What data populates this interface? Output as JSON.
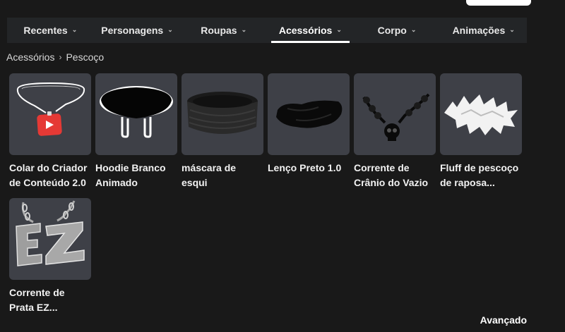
{
  "tabs": [
    {
      "label": "Recentes"
    },
    {
      "label": "Personagens"
    },
    {
      "label": "Roupas"
    },
    {
      "label": "Acessórios"
    },
    {
      "label": "Corpo"
    },
    {
      "label": "Animações"
    }
  ],
  "active_tab": "Acessórios",
  "breadcrumb": {
    "parent": "Acessórios",
    "current": "Pescoço"
  },
  "items": [
    {
      "name": "Colar do Criador de Conteúdo 2.0",
      "icon": "youtube-necklace-icon"
    },
    {
      "name": "Hoodie Branco Animado",
      "icon": "hoodie-collar-icon"
    },
    {
      "name": "máscara de esqui",
      "icon": "ski-mask-icon"
    },
    {
      "name": "Lenço Preto 1.0",
      "icon": "black-scarf-icon"
    },
    {
      "name": "Corrente de Crânio do Vazio",
      "icon": "skull-chain-icon"
    },
    {
      "name": "Fluff de pescoço de raposa...",
      "icon": "fox-fluff-icon"
    },
    {
      "name": "Corrente de Prata EZ...",
      "icon": "ez-chain-icon"
    }
  ],
  "advanced_label": "Avançado",
  "colors": {
    "background": "#191919",
    "tabbar": "#232527",
    "card": "#3e4047",
    "accent": "#ffffff",
    "pendant": "#e53935"
  }
}
